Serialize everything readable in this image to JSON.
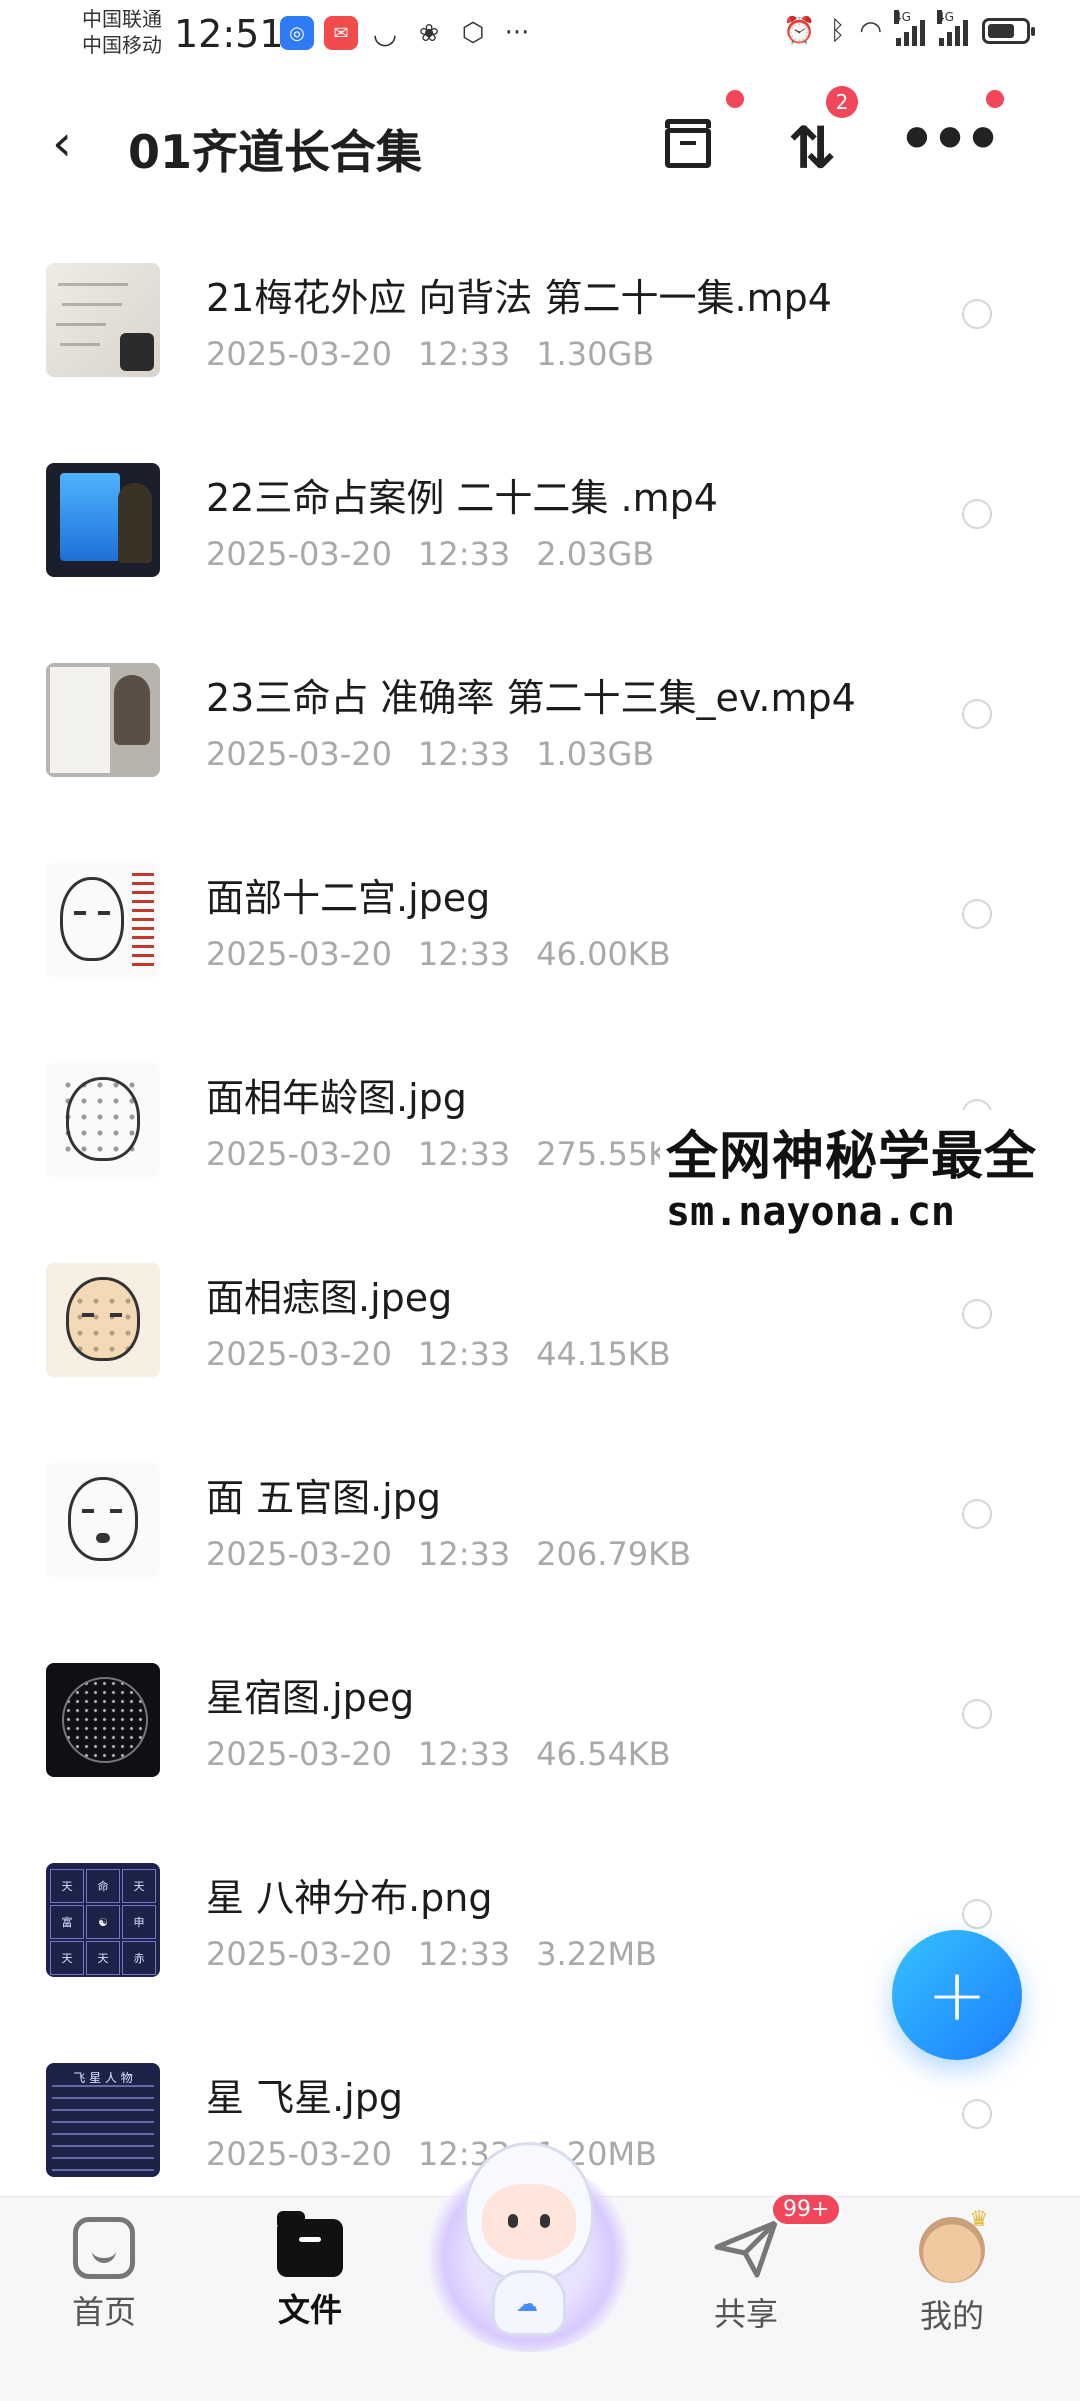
{
  "status_bar": {
    "carrier1": "中国联通",
    "carrier2": "中国移动",
    "time": "12:51",
    "network_tag1": "4G",
    "network_tag2": "4G"
  },
  "header": {
    "title": "01齐道长合集",
    "sort_badge": "2"
  },
  "files": [
    {
      "name": "21梅花外应 向背法  第二十一集.mp4",
      "date": "2025-03-20",
      "time": "12:33",
      "size": "1.30GB",
      "thumb": "video-paper"
    },
    {
      "name": "22三命占案例 二十二集 .mp4",
      "date": "2025-03-20",
      "time": "12:33",
      "size": "2.03GB",
      "thumb": "video-screen"
    },
    {
      "name": "23三命占 准确率 第二十三集_ev.mp4",
      "date": "2025-03-20",
      "time": "12:33",
      "size": "1.03GB",
      "thumb": "video-board"
    },
    {
      "name": "面部十二宫.jpeg",
      "date": "2025-03-20",
      "time": "12:33",
      "size": "46.00KB",
      "thumb": "face-legend"
    },
    {
      "name": "面相年龄图.jpg",
      "date": "2025-03-20",
      "time": "12:33",
      "size": "275.55KB",
      "thumb": "face-dots"
    },
    {
      "name": "面相痣图.jpeg",
      "date": "2025-03-20",
      "time": "12:33",
      "size": "44.15KB",
      "thumb": "face-moles"
    },
    {
      "name": "面  五官图.jpg",
      "date": "2025-03-20",
      "time": "12:33",
      "size": "206.79KB",
      "thumb": "face-features"
    },
    {
      "name": "星宿图.jpeg",
      "date": "2025-03-20",
      "time": "12:33",
      "size": "46.54KB",
      "thumb": "star-map"
    },
    {
      "name": "星 八神分布.png",
      "date": "2025-03-20",
      "time": "12:33",
      "size": "3.22MB",
      "thumb": "grid-chart"
    },
    {
      "name": "星  飞星.jpg",
      "date": "2025-03-20",
      "time": "12:33",
      "size": "1.20MB",
      "thumb": "grid-table"
    }
  ],
  "watermark": {
    "line1": "全网神秘学最全",
    "line2": "sm.nayona.cn"
  },
  "fab": {
    "label": "+"
  },
  "bottom_nav": {
    "home": "首页",
    "files": "文件",
    "share": "共享",
    "share_badge": "99+",
    "mine": "我的"
  },
  "colors": {
    "accent": "#1c7dff",
    "badge": "#f2475b",
    "meta_text": "#a9a9a9"
  }
}
